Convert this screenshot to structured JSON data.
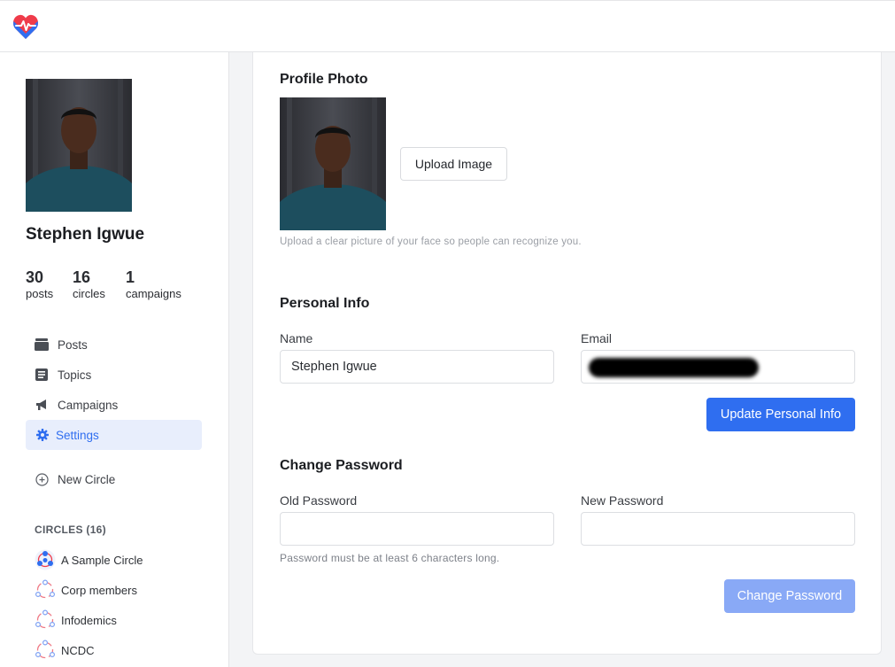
{
  "header": {
    "logo_icon": "heart-pulse-icon"
  },
  "profile": {
    "name": "Stephen Igwue",
    "stats": [
      {
        "value": "30",
        "label": "posts"
      },
      {
        "value": "16",
        "label": "circles"
      },
      {
        "value": "1",
        "label": "campaigns"
      }
    ]
  },
  "nav": {
    "items": [
      {
        "label": "Posts",
        "icon": "inbox-tray-icon"
      },
      {
        "label": "Topics",
        "icon": "document-list-icon"
      },
      {
        "label": "Campaigns",
        "icon": "megaphone-icon"
      },
      {
        "label": "Settings",
        "icon": "gear-icon",
        "active": true
      }
    ],
    "new_circle": {
      "label": "New Circle",
      "icon": "plus-circle-icon"
    }
  },
  "circles": {
    "heading": "CIRCLES (16)",
    "items": [
      {
        "label": "A Sample Circle"
      },
      {
        "label": "Corp members"
      },
      {
        "label": "Infodemics"
      },
      {
        "label": "NCDC"
      }
    ]
  },
  "settings": {
    "profile_photo": {
      "title": "Profile Photo",
      "upload_label": "Upload Image",
      "hint": "Upload a clear picture of your face so people can recognize you."
    },
    "personal_info": {
      "title": "Personal Info",
      "name_label": "Name",
      "name_value": "Stephen Igwue",
      "email_label": "Email",
      "email_value": "",
      "update_label": "Update Personal Info"
    },
    "password": {
      "title": "Change Password",
      "old_label": "Old Password",
      "new_label": "New Password",
      "hint": "Password must be at least 6 characters long.",
      "change_label": "Change Password"
    }
  },
  "colors": {
    "accent": "#2f6ef0",
    "accent_disabled": "#89a9f6",
    "active_bg": "#e8eefc",
    "logo_red": "#ef3b4a",
    "logo_blue": "#2f6ef0"
  }
}
